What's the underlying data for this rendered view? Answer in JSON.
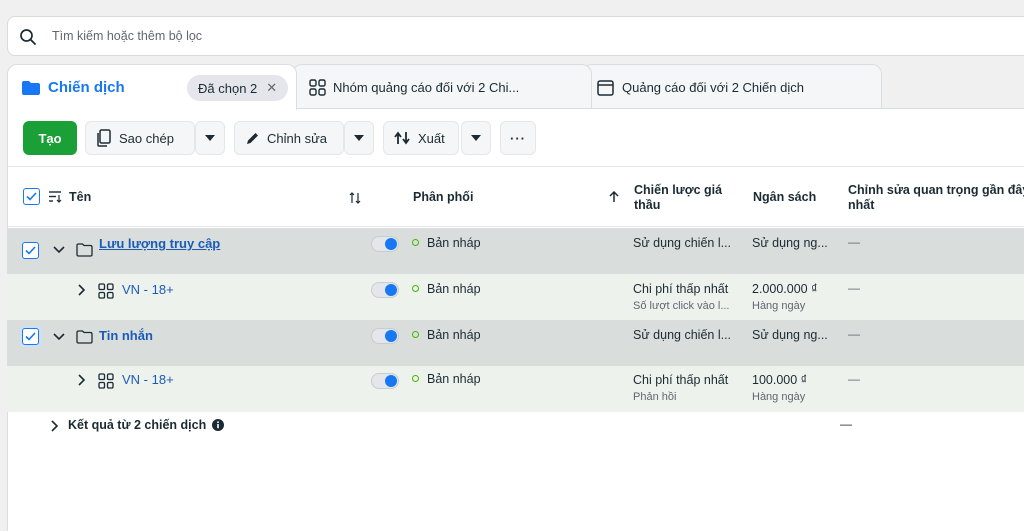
{
  "search": {
    "placeholder": "Tìm kiếm hoặc thêm bộ lọc"
  },
  "tabs": {
    "campaigns": {
      "label": "Chiến dịch",
      "chip": "Đã chọn 2"
    },
    "adsets": {
      "label": "Nhóm quảng cáo đối với 2 Chi..."
    },
    "ads": {
      "label": "Quảng cáo đối với 2 Chiến dịch"
    }
  },
  "toolbar": {
    "create": "Tạo",
    "copy": "Sao chép",
    "edit": "Chỉnh sửa",
    "export": "Xuất",
    "more": "···"
  },
  "columns": {
    "name": "Tên",
    "delivery": "Phân phối",
    "bid_strategy_1": "Chiến lược giá",
    "bid_strategy_2": "thầu",
    "budget": "Ngân sách",
    "edit_1": "Chỉnh sửa quan trọng gần đây",
    "edit_2": "nhất"
  },
  "rows": [
    {
      "name": "Lưu lượng truy cập",
      "status": "Bản nháp",
      "bid": "Sử dụng chiến l...",
      "budget": "Sử dụng ng...",
      "edit": "—"
    },
    {
      "name": "VN - 18+",
      "status": "Bản nháp",
      "bid": "Chi phí thấp nhất",
      "bid_sub": "Số lượt click vào l...",
      "budget": "2.000.000 ₫",
      "budget_sub": "Hàng ngày",
      "edit": "—"
    },
    {
      "name": "Tin nhắn",
      "status": "Bản nháp",
      "bid": "Sử dụng chiến l...",
      "budget": "Sử dụng ng...",
      "edit": "—"
    },
    {
      "name": "VN - 18+",
      "status": "Bản nháp",
      "bid": "Chi phí thấp nhất",
      "bid_sub": "Phản hồi",
      "budget": "100.000 ₫",
      "budget_sub": "Hàng ngày",
      "edit": "—"
    }
  ],
  "summary": {
    "label": "Kết quả từ 2 chiến dịch",
    "edit": "—"
  }
}
